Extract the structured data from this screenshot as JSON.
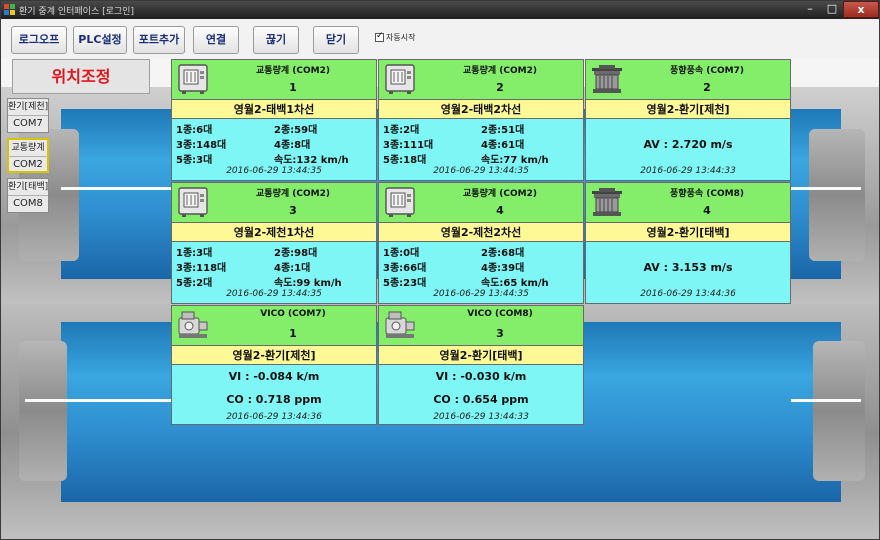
{
  "window": {
    "title": "환기 중계 인터페이스 [로그인]",
    "minimize": "–",
    "maximize": "□",
    "close": "x"
  },
  "toolbar": {
    "logoff_label": "로그오프",
    "plc_label": "PLC설정",
    "port_add_label": "포트추가",
    "connect_label": "연결",
    "disconnect_label": "끊기",
    "close_label": "닫기",
    "autostart_label": "자동시작",
    "autostart_checked": true
  },
  "position_button": "위치조정",
  "ports": [
    {
      "name": "환기[제천]",
      "com": "COM7",
      "selected": false
    },
    {
      "name": "교통량계",
      "com": "COM2",
      "selected": true
    },
    {
      "name": "환기[태백]",
      "com": "COM8",
      "selected": false
    }
  ],
  "traffic_cards": [
    {
      "title": "교통량계 (COM2)",
      "number": "1",
      "location": "영월2-태백1차선",
      "r1a": "1종:6대",
      "r1b": "2종:59대",
      "r2a": "3종:148대",
      "r2b": "4종:8대",
      "r3a": "5종:3대",
      "r3b": "속도:132 km/h",
      "time": "2016-06-29 13:44:35"
    },
    {
      "title": "교통량계 (COM2)",
      "number": "2",
      "location": "영월2-태백2차선",
      "r1a": "1종:2대",
      "r1b": "2종:51대",
      "r2a": "3종:111대",
      "r2b": "4종:61대",
      "r3a": "5종:18대",
      "r3b": "속도:77 km/h",
      "time": "2016-06-29 13:44:35"
    },
    {
      "title": "교통량계 (COM2)",
      "number": "3",
      "location": "영월2-제천1차선",
      "r1a": "1종:3대",
      "r1b": "2종:98대",
      "r2a": "3종:118대",
      "r2b": "4종:1대",
      "r3a": "5종:2대",
      "r3b": "속도:99 km/h",
      "time": "2016-06-29 13:44:35"
    },
    {
      "title": "교통량계 (COM2)",
      "number": "4",
      "location": "영월2-제천2차선",
      "r1a": "1종:0대",
      "r1b": "2종:68대",
      "r2a": "3종:66대",
      "r2b": "4종:39대",
      "r3a": "5종:23대",
      "r3b": "속도:65 km/h",
      "time": "2016-06-29 13:44:35"
    }
  ],
  "wind_cards": [
    {
      "title": "풍향풍속 (COM7)",
      "number": "2",
      "location": "영월2-환기[제천]",
      "value": "AV : 2.720 m/s",
      "time": "2016-06-29 13:44:33"
    },
    {
      "title": "풍향풍속 (COM8)",
      "number": "4",
      "location": "영월2-환기[태백]",
      "value": "AV : 3.153 m/s",
      "time": "2016-06-29 13:44:36"
    }
  ],
  "vico_cards": [
    {
      "title": "VICO (COM7)",
      "number": "1",
      "location": "영월2-환기[제천]",
      "vi": "VI : -0.084 k/m",
      "co": "CO : 0.718 ppm",
      "time": "2016-06-29 13:44:36"
    },
    {
      "title": "VICO (COM8)",
      "number": "3",
      "location": "영월2-환기[태백]",
      "vi": "VI : -0.030 k/m",
      "co": "CO : 0.654 ppm",
      "time": "2016-06-29 13:44:33"
    }
  ],
  "colors": {
    "card_header": "#84ee6a",
    "card_location": "#fff896",
    "card_body": "#7ef6f6",
    "position_text": "#e0141a",
    "tube": "#2f8fd0"
  }
}
